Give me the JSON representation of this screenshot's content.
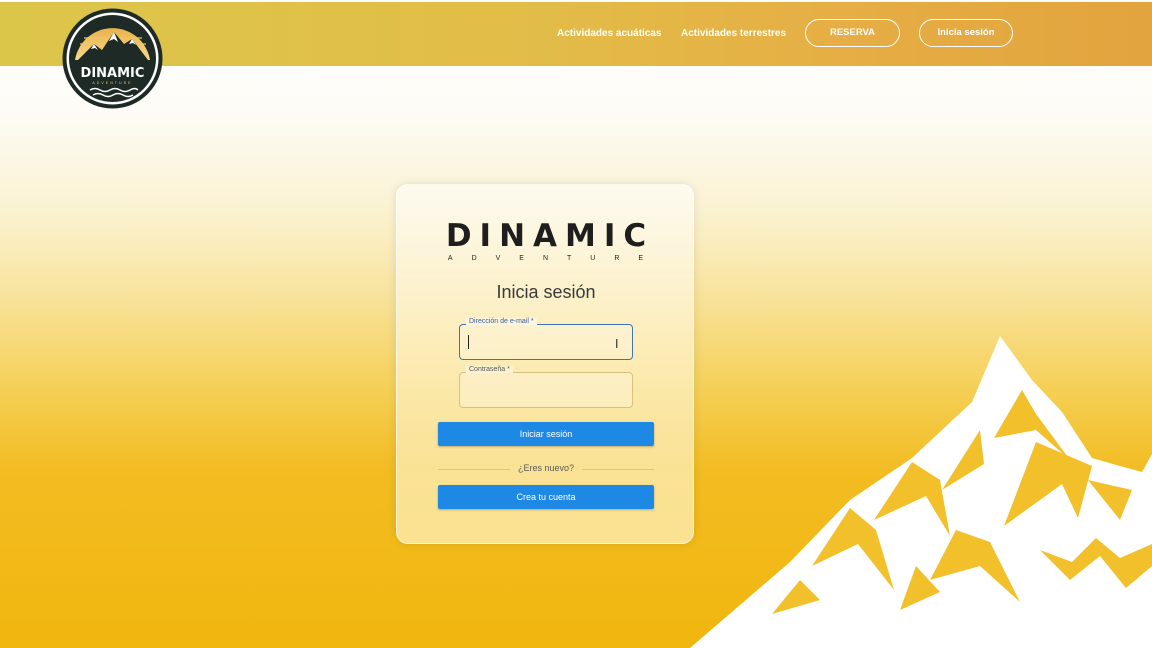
{
  "header": {
    "logo": {
      "brand": "DINAMIC",
      "tagline": "ADVENTURE"
    },
    "nav": {
      "water_activities": "Actividades acuáticas",
      "land_activities": "Actividades terrestres",
      "booking": "RESERVA",
      "login": "Inicia sesión"
    }
  },
  "login_card": {
    "brand": "DINAMIC",
    "brand_sub": "ADVENTURE",
    "title": "Inicia sesión",
    "email_field": {
      "label": "Dirección de e-mail *",
      "value": ""
    },
    "password_field": {
      "label": "Contraseña *",
      "value": ""
    },
    "submit_label": "Iniciar sesión",
    "divider_text": "¿Eres nuevo?",
    "create_account_label": "Crea tu cuenta"
  },
  "colors": {
    "header_gradient_start": "#dcc64a",
    "header_gradient_end": "#e2a43e",
    "primary_button": "#1e88e5",
    "background_yellow": "#f1b60e",
    "focus_border": "#3f74b8"
  },
  "icons": [
    "mountain-logo-icon",
    "text-cursor-icon",
    "mountain-illustration"
  ]
}
